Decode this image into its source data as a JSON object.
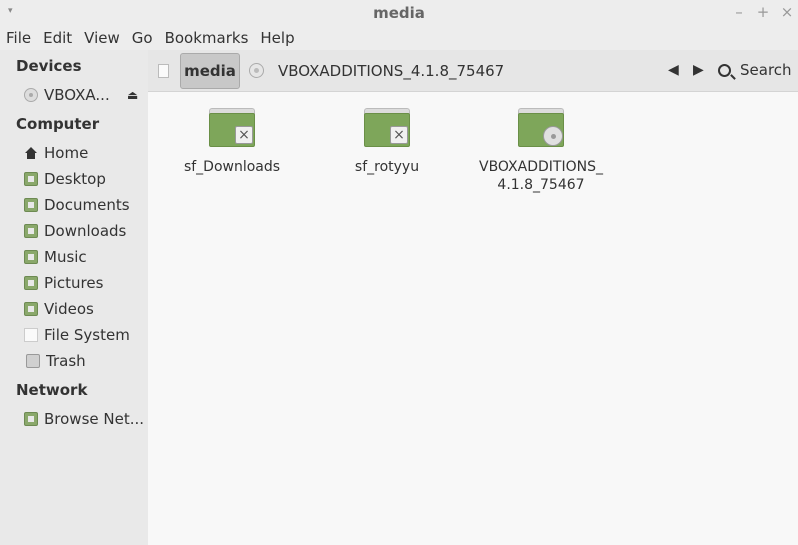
{
  "window": {
    "title": "media",
    "menu_arrow": "▾",
    "minimize": "–",
    "maximize": "+",
    "close": "×"
  },
  "menubar": [
    "File",
    "Edit",
    "View",
    "Go",
    "Bookmarks",
    "Help"
  ],
  "sidebar": {
    "devices_title": "Devices",
    "devices": [
      {
        "label": "VBOXA...",
        "icon": "disc-icon",
        "eject": "⏏"
      }
    ],
    "computer_title": "Computer",
    "computer": [
      {
        "label": "Home",
        "icon": "home-icon"
      },
      {
        "label": "Desktop",
        "icon": "desktop-folder-icon"
      },
      {
        "label": "Documents",
        "icon": "documents-folder-icon"
      },
      {
        "label": "Downloads",
        "icon": "downloads-folder-icon"
      },
      {
        "label": "Music",
        "icon": "music-folder-icon"
      },
      {
        "label": "Pictures",
        "icon": "pictures-folder-icon"
      },
      {
        "label": "Videos",
        "icon": "videos-folder-icon"
      },
      {
        "label": "File System",
        "icon": "file-system-icon"
      },
      {
        "label": "Trash",
        "icon": "trash-icon"
      }
    ],
    "network_title": "Network",
    "network": [
      {
        "label": "Browse Net...",
        "icon": "network-folder-icon"
      }
    ]
  },
  "toolbar": {
    "breadcrumb_active": "media",
    "breadcrumb_next": "VBOXADDITIONS_4.1.8_75467",
    "back": "◀",
    "forward": "▶",
    "search_label": "Search"
  },
  "files": [
    {
      "name": "sf_Downloads",
      "emblem": "x"
    },
    {
      "name": "sf_rotyyu",
      "emblem": "x"
    },
    {
      "name_line1": "VBOXADDITIONS_",
      "name_line2": "4.1.8_75467",
      "emblem": "disc"
    }
  ],
  "colors": {
    "folder_green": "#7ea65a",
    "sidebar_bg": "#e9e9e9",
    "content_bg": "#f8f8f8"
  }
}
